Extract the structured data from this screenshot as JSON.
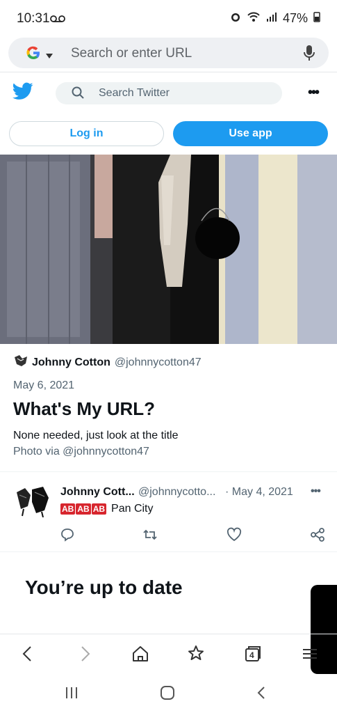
{
  "status_bar": {
    "time": "10:31",
    "battery": "47%"
  },
  "browser": {
    "url_placeholder": "Search or enter URL",
    "tab_count": "4"
  },
  "twitter": {
    "search_placeholder": "Search Twitter",
    "login_label": "Log in",
    "use_app_label": "Use app"
  },
  "article": {
    "author_name": "Johnny Cotton",
    "author_handle": "@johnnycotton47",
    "date": "May 6, 2021",
    "title": "What's My URL?",
    "description": "None needed, just look at the title",
    "credit": "Photo via @johnnycotton47"
  },
  "tweet": {
    "name": "Johnny Cott...",
    "handle": "@johnnycotto...",
    "date": "· May 4, 2021",
    "ab_tags": [
      "AB",
      "AB",
      "AB"
    ],
    "text": "Pan City"
  },
  "feed": {
    "up_to_date": "You’re up to date"
  },
  "colors": {
    "twitter_blue": "#1d9bf0",
    "ab_red": "#d7262e"
  }
}
